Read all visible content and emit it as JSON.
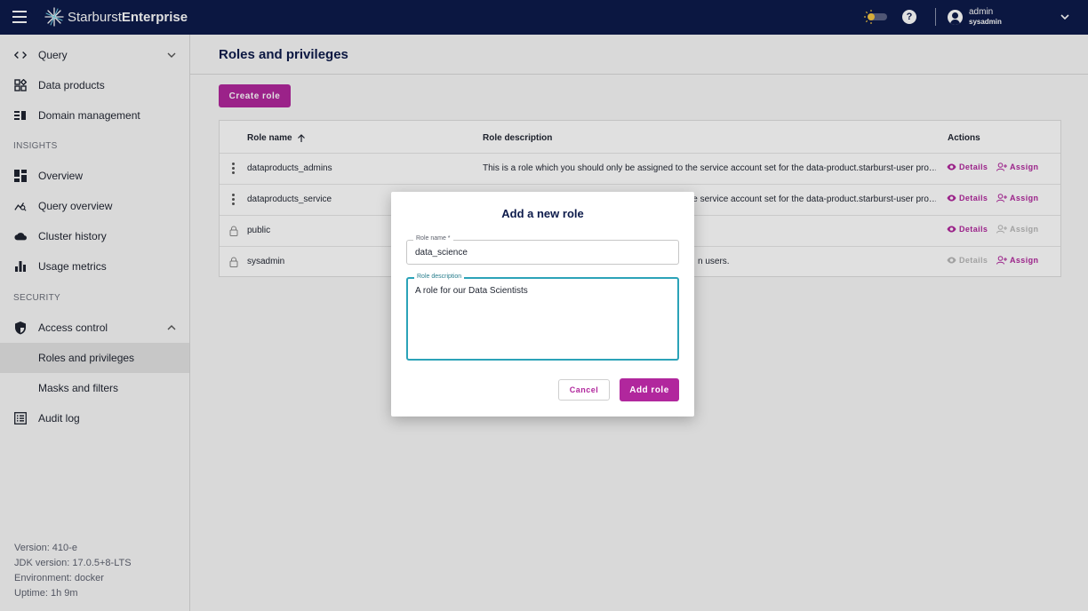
{
  "app": {
    "brand_light": "Starburst",
    "brand_bold": "Enterprise",
    "user_name": "admin",
    "user_role": "sysadmin",
    "help_symbol": "?"
  },
  "colors": {
    "navy": "#0d1b4b",
    "accent": "#b1279d",
    "focus": "#2ba3b8"
  },
  "sidebar": {
    "items": [
      {
        "label": "Query",
        "icon": "code-icon"
      },
      {
        "label": "Data products",
        "icon": "data-products-icon"
      },
      {
        "label": "Domain management",
        "icon": "domain-icon"
      },
      {
        "label": "Overview",
        "icon": "dashboard-icon"
      },
      {
        "label": "Query overview",
        "icon": "query-insights-icon"
      },
      {
        "label": "Cluster history",
        "icon": "cloud-icon"
      },
      {
        "label": "Usage metrics",
        "icon": "bar-chart-icon"
      },
      {
        "label": "Access control",
        "icon": "shield-icon"
      },
      {
        "label": "Roles and privileges",
        "icon": ""
      },
      {
        "label": "Masks and filters",
        "icon": ""
      },
      {
        "label": "Audit log",
        "icon": "list-icon"
      }
    ],
    "sections": {
      "insights": "INSIGHTS",
      "security": "SECURITY"
    },
    "version": {
      "version": "Version: 410-e",
      "jdk": "JDK version: 17.0.5+8-LTS",
      "environment": "Environment: docker",
      "uptime": "Uptime: 1h 9m"
    }
  },
  "main": {
    "title": "Roles and privileges",
    "create_button": "Create role",
    "table": {
      "headers": {
        "name": "Role name",
        "description": "Role description",
        "actions": "Actions"
      },
      "rows": [
        {
          "name": "dataproducts_admins",
          "description": "This is a role which you should only be assigned to the service account set for the data-product.starburst-user pro…",
          "details": "Details",
          "assign": "Assign"
        },
        {
          "name": "dataproducts_service",
          "description": "This is a role which you should only be assigned to the service account set for the data-product.starburst-user pro…",
          "details": "Details",
          "assign": "Assign"
        },
        {
          "name": "public",
          "description": "",
          "details": "Details",
          "assign": "Assign"
        },
        {
          "name": "sysadmin",
          "description": "n users.",
          "details": "Details",
          "assign": "Assign"
        }
      ]
    }
  },
  "dialog": {
    "title": "Add a new role",
    "name_label": "Role name *",
    "name_value": "data_science",
    "desc_label": "Role description",
    "desc_value": "A role for our Data Scientists",
    "cancel": "Cancel",
    "submit": "Add role"
  }
}
